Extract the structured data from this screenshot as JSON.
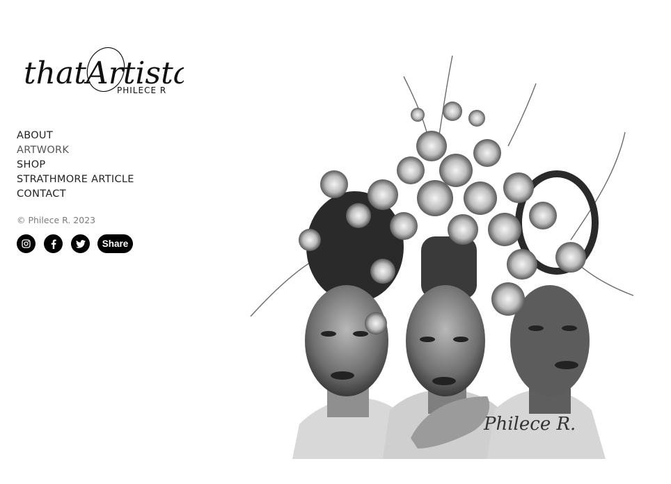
{
  "logo": {
    "script_text": "thatArtista",
    "sub_text": "PHILECE R"
  },
  "nav": {
    "items": [
      {
        "label": "ABOUT"
      },
      {
        "label": "ARTWORK"
      },
      {
        "label": "SHOP"
      },
      {
        "label": "STRATHMORE ARTICLE"
      },
      {
        "label": "CONTACT"
      }
    ]
  },
  "footer": {
    "copyright": "© Philece R. 2023"
  },
  "social": {
    "icons": [
      "instagram-icon",
      "facebook-icon",
      "twitter-icon"
    ],
    "share_label": "Share"
  },
  "artwork": {
    "signature": "Philece R."
  }
}
